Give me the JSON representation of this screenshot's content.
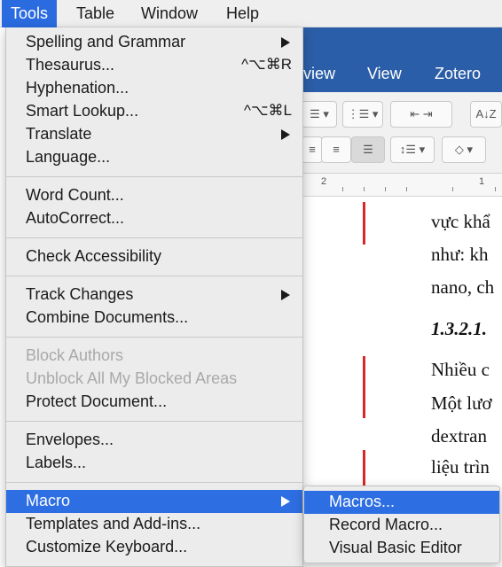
{
  "menubar": {
    "items": [
      "Tools",
      "Table",
      "Window",
      "Help"
    ],
    "active": "Tools"
  },
  "ribbon": {
    "tabs": [
      "view",
      "View",
      "Zotero"
    ],
    "bg_color": "#2b5ea8"
  },
  "ruler": {
    "labels": [
      "2",
      "1"
    ]
  },
  "document": {
    "lines": [
      "vực khẩ",
      "như: kh",
      "nano, ch",
      "1.3.2.1.",
      "Nhiều c",
      "Một lươ",
      "dextran",
      "liệu trìn"
    ]
  },
  "tools_menu": {
    "items": [
      {
        "label": "Spelling and Grammar",
        "submenu": true
      },
      {
        "label": "Thesaurus...",
        "shortcut": "^⌥⌘R"
      },
      {
        "label": "Hyphenation..."
      },
      {
        "label": "Smart Lookup...",
        "shortcut": "^⌥⌘L"
      },
      {
        "label": "Translate",
        "submenu": true
      },
      {
        "label": "Language..."
      },
      {
        "label": "Word Count..."
      },
      {
        "label": "AutoCorrect..."
      },
      {
        "label": "Check Accessibility"
      },
      {
        "label": "Track Changes",
        "submenu": true
      },
      {
        "label": "Combine Documents..."
      },
      {
        "label": "Block Authors",
        "disabled": true
      },
      {
        "label": "Unblock All My Blocked Areas",
        "disabled": true
      },
      {
        "label": "Protect Document..."
      },
      {
        "label": "Envelopes..."
      },
      {
        "label": "Labels..."
      },
      {
        "label": "Macro",
        "submenu": true,
        "highlighted": true
      },
      {
        "label": "Templates and Add-ins..."
      },
      {
        "label": "Customize Keyboard..."
      }
    ]
  },
  "macro_submenu": {
    "items": [
      {
        "label": "Macros...",
        "highlighted": true
      },
      {
        "label": "Record Macro..."
      },
      {
        "label": "Visual Basic Editor"
      }
    ]
  },
  "colors": {
    "highlight": "#2d6fe3",
    "revision_bar": "#d62828"
  }
}
